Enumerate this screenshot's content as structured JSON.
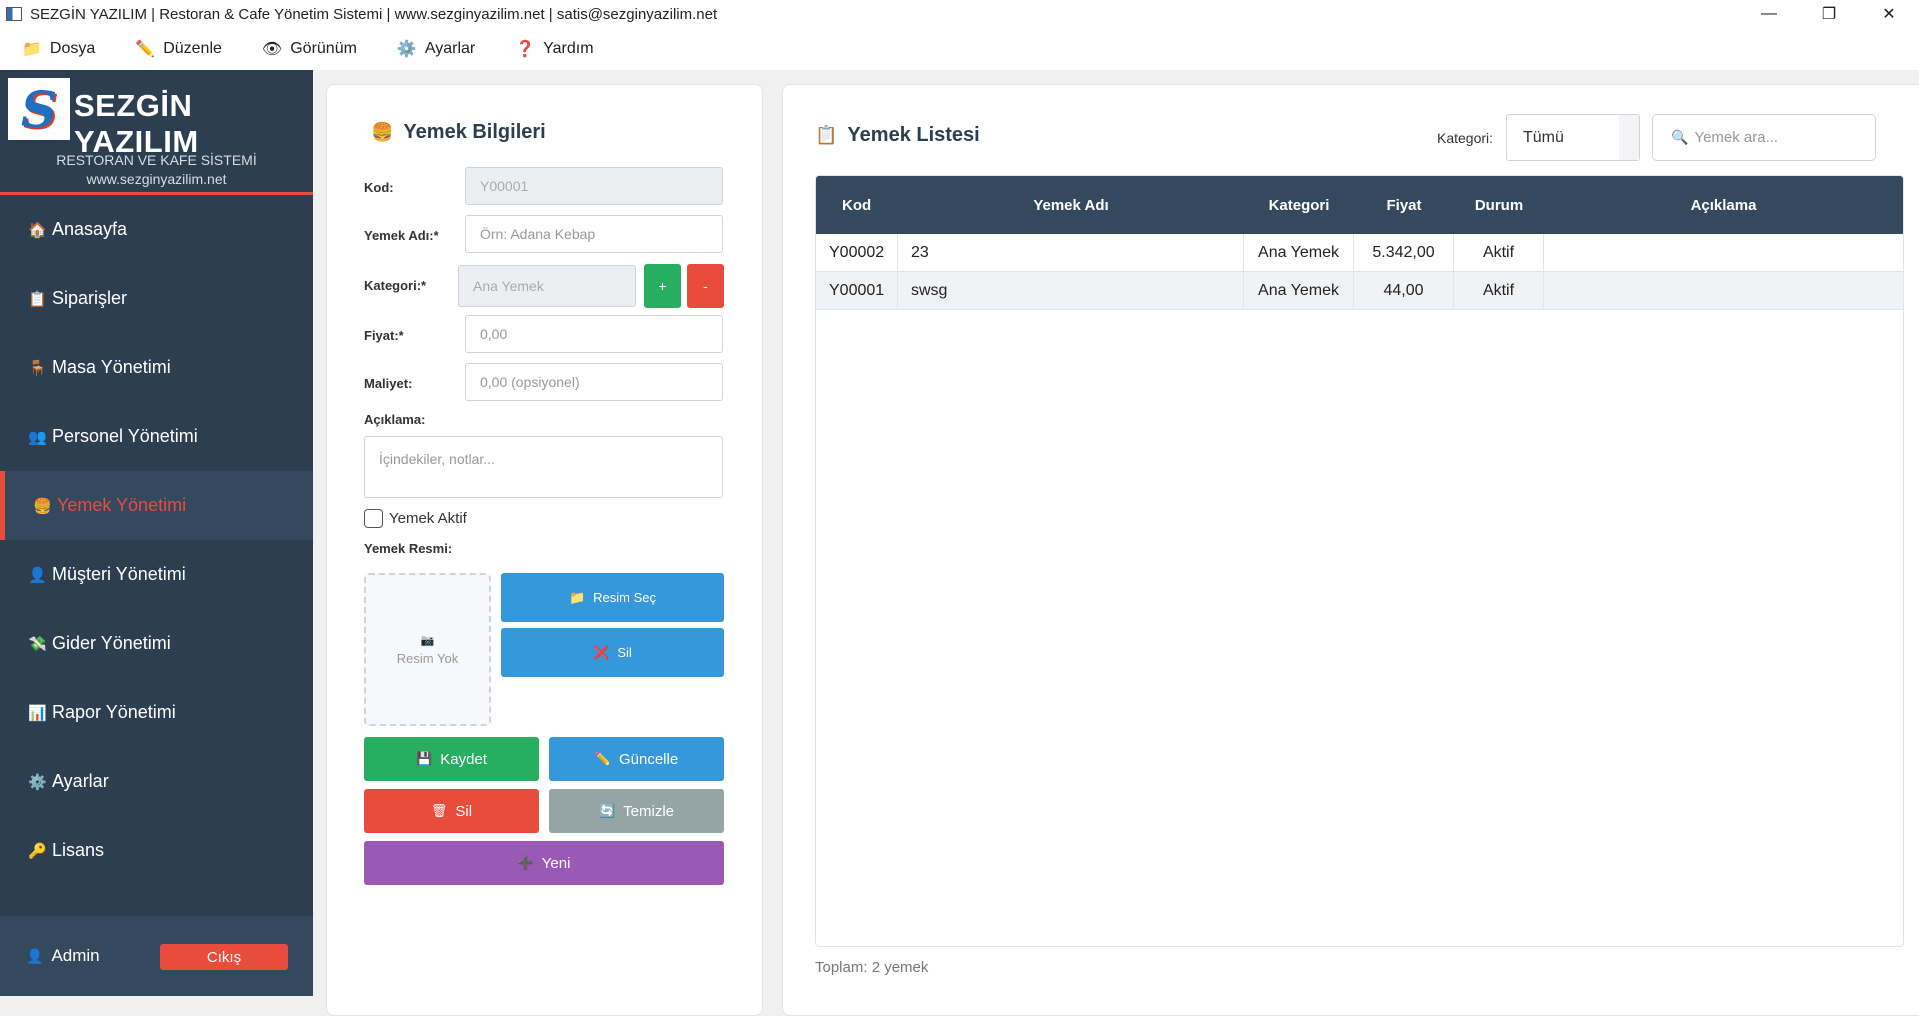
{
  "window": {
    "title": "SEZGİN YAZILIM | Restoran & Cafe Yönetim Sistemi | www.sezginyazilim.net | satis@sezginyazilim.net",
    "controls": [
      "—",
      "❐",
      "✕"
    ]
  },
  "menu": [
    {
      "icon": "📁",
      "label": "Dosya"
    },
    {
      "icon": "✏️",
      "label": "Düzenle"
    },
    {
      "icon": "👁",
      "label": "Görünüm"
    },
    {
      "icon": "⚙️",
      "label": "Ayarlar"
    },
    {
      "icon": "❓",
      "label": "Yardım"
    }
  ],
  "sidebar": {
    "brand_title": "SEZGİN YAZILIM",
    "brand_sub": "RESTORAN VE KAFE SİSTEMİ",
    "brand_url": "www.sezginyazilim.net",
    "items": [
      {
        "icon": "🏠",
        "label": "Anasayfa"
      },
      {
        "icon": "📋",
        "label": "Siparişler"
      },
      {
        "icon": "🪑",
        "label": "Masa Yönetimi"
      },
      {
        "icon": "👥",
        "label": "Personel Yönetimi"
      },
      {
        "icon": "🍔",
        "label": "Yemek Yönetimi"
      },
      {
        "icon": "👤",
        "label": "Müşteri Yönetimi"
      },
      {
        "icon": "💸",
        "label": "Gider Yönetimi"
      },
      {
        "icon": "📊",
        "label": "Rapor Yönetimi"
      },
      {
        "icon": "⚙️",
        "label": "Ayarlar"
      },
      {
        "icon": "🔑",
        "label": "Lisans"
      }
    ],
    "active_index": 4,
    "user_icon": "👤",
    "user": "Admin",
    "logout": "Cıkış"
  },
  "form": {
    "title_icon": "🍔",
    "title": "Yemek Bilgileri",
    "kod_label": "Kod:",
    "kod_placeholder": "Y00001",
    "ad_label": "Yemek Adı:*",
    "ad_placeholder": "Örn: Adana Kebap",
    "kategori_label": "Kategori:*",
    "kategori_value": "Ana Yemek",
    "add_cat": "+",
    "remove_cat": "-",
    "fiyat_label": "Fiyat:*",
    "fiyat_placeholder": "0,00",
    "maliyet_label": "Maliyet:",
    "maliyet_placeholder": "0,00 (opsiyonel)",
    "aciklama_label": "Açıklama:",
    "aciklama_placeholder": "İçindekiler, notlar...",
    "aktif_label": "Yemek Aktif",
    "aktif_checked": false,
    "resim_label": "Yemek Resmi:",
    "no_image_icon": "📷",
    "no_image": "Resim Yok",
    "resim_sec_icon": "📁",
    "resim_sec": "Resim Seç",
    "resim_sil_icon": "❌",
    "resim_sil": "Sil",
    "kaydet_icon": "💾",
    "kaydet": "Kaydet",
    "guncelle_icon": "✏️",
    "guncelle": "Güncelle",
    "sil_icon": "🗑",
    "sil": "Sil",
    "temizle_icon": "🔄",
    "temizle": "Temizle",
    "yeni_icon": "➕",
    "yeni": "Yeni"
  },
  "list": {
    "title_icon": "📋",
    "title": "Yemek Listesi",
    "kategori_label": "Kategori:",
    "kategori_value": "Tümü",
    "search_icon": "🔍",
    "search_placeholder": "Yemek ara...",
    "columns": [
      "Kod",
      "Yemek Adı",
      "Kategori",
      "Fiyat",
      "Durum",
      "Açıklama"
    ],
    "rows": [
      [
        "Y00002",
        "23",
        "Ana Yemek",
        "5.342,00",
        "Aktif",
        ""
      ],
      [
        "Y00001",
        "swsg",
        "Ana Yemek",
        "44,00",
        "Aktif",
        ""
      ]
    ],
    "footer": "Toplam: 2 yemek"
  },
  "colors": {
    "sidebar": "#2c3e50",
    "accent_red": "#e74c3c",
    "green": "#27ae60",
    "blue": "#3498db",
    "grey": "#95a5a6",
    "purple": "#9b59b6"
  }
}
